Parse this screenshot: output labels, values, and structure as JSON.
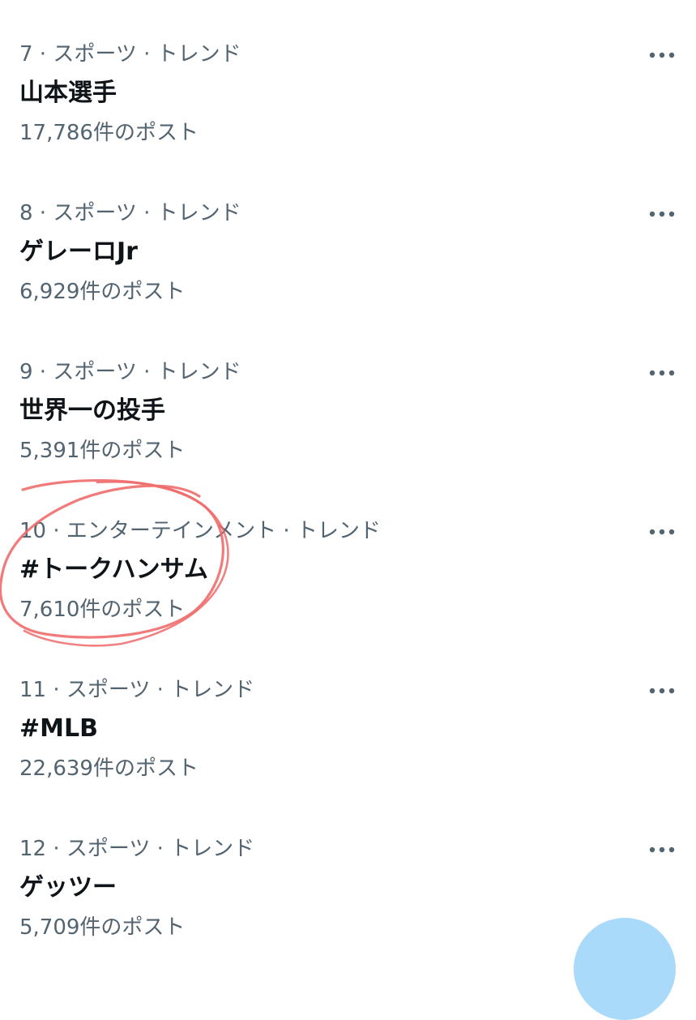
{
  "trends": [
    {
      "meta": "7 · スポーツ · トレンド",
      "title": "山本選手",
      "count": "17,786件のポスト"
    },
    {
      "meta": "8 · スポーツ · トレンド",
      "title": "ゲレーロJr",
      "count": "6,929件のポスト"
    },
    {
      "meta": "9 · スポーツ · トレンド",
      "title": "世界一の投手",
      "count": "5,391件のポスト"
    },
    {
      "meta": "10 · エンターテインメント · トレンド",
      "title": "#トークハンサム",
      "count": "7,610件のポスト"
    },
    {
      "meta": "11 · スポーツ · トレンド",
      "title": "#MLB",
      "count": "22,639件のポスト"
    },
    {
      "meta": "12 · スポーツ · トレンド",
      "title": "ゲッツー",
      "count": "5,709件のポスト"
    }
  ],
  "colors": {
    "secondary_text": "#536471",
    "primary_text": "#0f1419",
    "annotation": "#ef6b6b",
    "fab": "#8ecdf8"
  },
  "icons": {
    "more": "more-dots-icon",
    "fab": "compose-icon"
  }
}
